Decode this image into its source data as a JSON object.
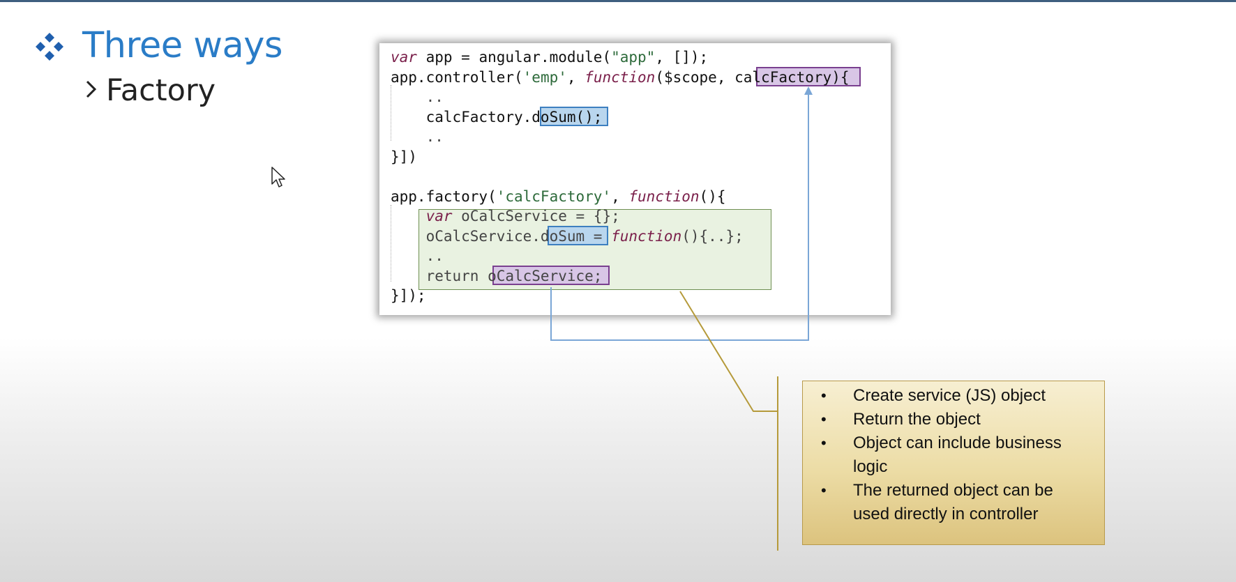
{
  "slide": {
    "title": "Three ways",
    "subtitle": "Factory",
    "bullet_icon": "diamond-cluster-icon",
    "chevron_icon": "chevron-right-icon",
    "cursor_icon": "mouse-pointer-icon"
  },
  "code": {
    "lines": [
      {
        "t": [
          [
            "kw",
            "var"
          ],
          [
            "n",
            " app = angular.module("
          ],
          [
            "str",
            "\"app\""
          ],
          [
            "n",
            ", []);"
          ]
        ]
      },
      {
        "t": [
          [
            "n",
            "app.controller("
          ],
          [
            "str",
            "'emp'"
          ],
          [
            "n",
            ", "
          ],
          [
            "kw",
            "function"
          ],
          [
            "n",
            "($scope, calcFactory){"
          ]
        ]
      },
      {
        "t": [
          [
            "gr",
            "    .."
          ]
        ]
      },
      {
        "t": [
          [
            "n",
            "    calcFactory.doSum();"
          ]
        ]
      },
      {
        "t": [
          [
            "gr",
            "    .."
          ]
        ]
      },
      {
        "t": [
          [
            "n",
            "}])"
          ]
        ]
      },
      {
        "t": [
          [
            "n",
            ""
          ]
        ]
      },
      {
        "t": [
          [
            "n",
            "app.factory("
          ],
          [
            "str",
            "'calcFactory'"
          ],
          [
            "n",
            ", "
          ],
          [
            "kw",
            "function"
          ],
          [
            "n",
            "(){"
          ]
        ]
      },
      {
        "t": [
          [
            "kw",
            "    var"
          ],
          [
            "gr",
            " oCalcService = {};"
          ]
        ]
      },
      {
        "t": [
          [
            "gr",
            "    oCalcService.doSum = "
          ],
          [
            "kw",
            "function"
          ],
          [
            "gr",
            "(){..};"
          ]
        ]
      },
      {
        "t": [
          [
            "gr",
            "    .."
          ]
        ]
      },
      {
        "t": [
          [
            "gr",
            "    return oCalcService;"
          ]
        ]
      },
      {
        "t": [
          [
            "n",
            "}]);"
          ]
        ]
      }
    ]
  },
  "notes": {
    "items": [
      "Create service (JS) object",
      "Return the object",
      "Object can include business logic",
      "The returned object can be used directly in controller"
    ]
  },
  "colors": {
    "title": "#2a7cc7",
    "purple_highlight": "#d8c6e6",
    "blue_highlight": "#b9d6ee",
    "green_box": "#e9f2e1",
    "note_bg": "#ecdca5"
  }
}
